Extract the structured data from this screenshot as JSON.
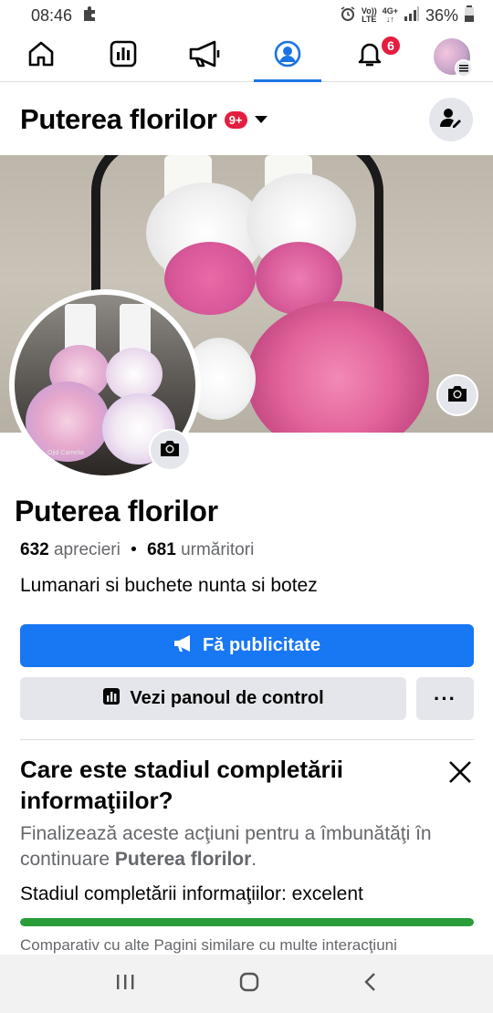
{
  "status_bar": {
    "time": "08:46",
    "volte_top": "Vo))",
    "volte_bottom": "LTE",
    "network": "4G+",
    "battery": "36%"
  },
  "nav": {
    "notifications_count": "6",
    "active_tab": "profile"
  },
  "header": {
    "title": "Puterea florilor",
    "badge": "9+"
  },
  "profile": {
    "name": "Puterea florilor",
    "likes_count": "632",
    "likes_label": "aprecieri",
    "separator": "•",
    "followers_count": "681",
    "followers_label": "urmăritori",
    "description": "Lumanari si buchete nunta si botez",
    "watermark": "Ojid Camelia"
  },
  "actions": {
    "primary_label": "Fă publicitate",
    "secondary_label": "Vezi panoul de control",
    "more_label": "···"
  },
  "completion": {
    "title": "Care este stadiul completării informaţiilor?",
    "subtitle_prefix": "Finalizează aceste acţiuni pentru a îmbunătăţi în continuare ",
    "subtitle_page": "Puterea florilor",
    "subtitle_suffix": ".",
    "status": "Stadiul completării informaţiilor: excelent",
    "progress": 1.0,
    "footer": "Comparativ cu alte Pagini similare cu multe interacţiuni"
  },
  "colors": {
    "accent": "#1877f2",
    "progress": "#2a9d3a",
    "badge": "#e41e3f"
  }
}
